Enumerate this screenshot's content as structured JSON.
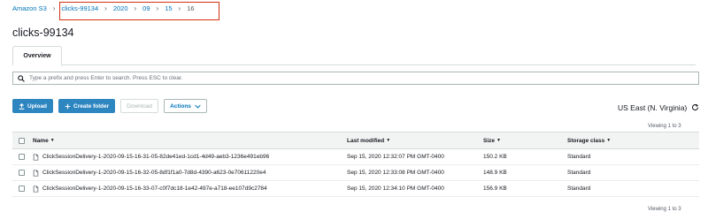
{
  "breadcrumb": {
    "root": "Amazon S3",
    "path": [
      "clicks-99134",
      "2020",
      "09",
      "15"
    ],
    "current": "16",
    "separator": "›"
  },
  "page_title": "clicks-99134",
  "tabs": [
    {
      "label": "Overview",
      "active": true
    }
  ],
  "search": {
    "placeholder": "Type a prefix and press Enter to search. Press ESC to clear."
  },
  "toolbar": {
    "upload_label": "Upload",
    "create_folder_label": "Create folder",
    "download_label": "Download",
    "actions_label": "Actions"
  },
  "region": "US East (N. Virginia)",
  "viewing_top": "Viewing 1 to 3",
  "viewing_bottom": "Viewing 1 to 3",
  "table": {
    "columns": {
      "name": "Name",
      "last_modified": "Last modified",
      "size": "Size",
      "storage_class": "Storage class"
    },
    "rows": [
      {
        "name": "ClickSessionDelivery-1-2020-09-15-16-31-05-82de41ed-1cd1-4d49-aeb3-1236e491eb96",
        "last_modified": "Sep 15, 2020 12:32:07 PM GMT-0400",
        "size": "150.2 KB",
        "storage_class": "Standard"
      },
      {
        "name": "ClickSessionDelivery-1-2020-09-15-16-32-05-8df1f1a0-7d8d-4390-a623-0e70611220e4",
        "last_modified": "Sep 15, 2020 12:33:08 PM GMT-0400",
        "size": "148.9 KB",
        "storage_class": "Standard"
      },
      {
        "name": "ClickSessionDelivery-1-2020-09-15-16-33-07-c0f7dc18-1e42-497e-a718-ee107d9c2784",
        "last_modified": "Sep 15, 2020 12:34:10 PM GMT-0400",
        "size": "156.9 KB",
        "storage_class": "Standard"
      }
    ]
  },
  "colors": {
    "link": "#0073bb",
    "primary_button": "#2e86c1",
    "highlight_box": "#d13212",
    "header_bg": "#f2f3f3"
  },
  "icons": {
    "search": "search-icon",
    "upload": "upload-icon",
    "add": "plus-icon",
    "dropdown": "caret-down-icon",
    "refresh": "refresh-icon",
    "file": "file-icon",
    "sort": "sort-caret-icon"
  }
}
